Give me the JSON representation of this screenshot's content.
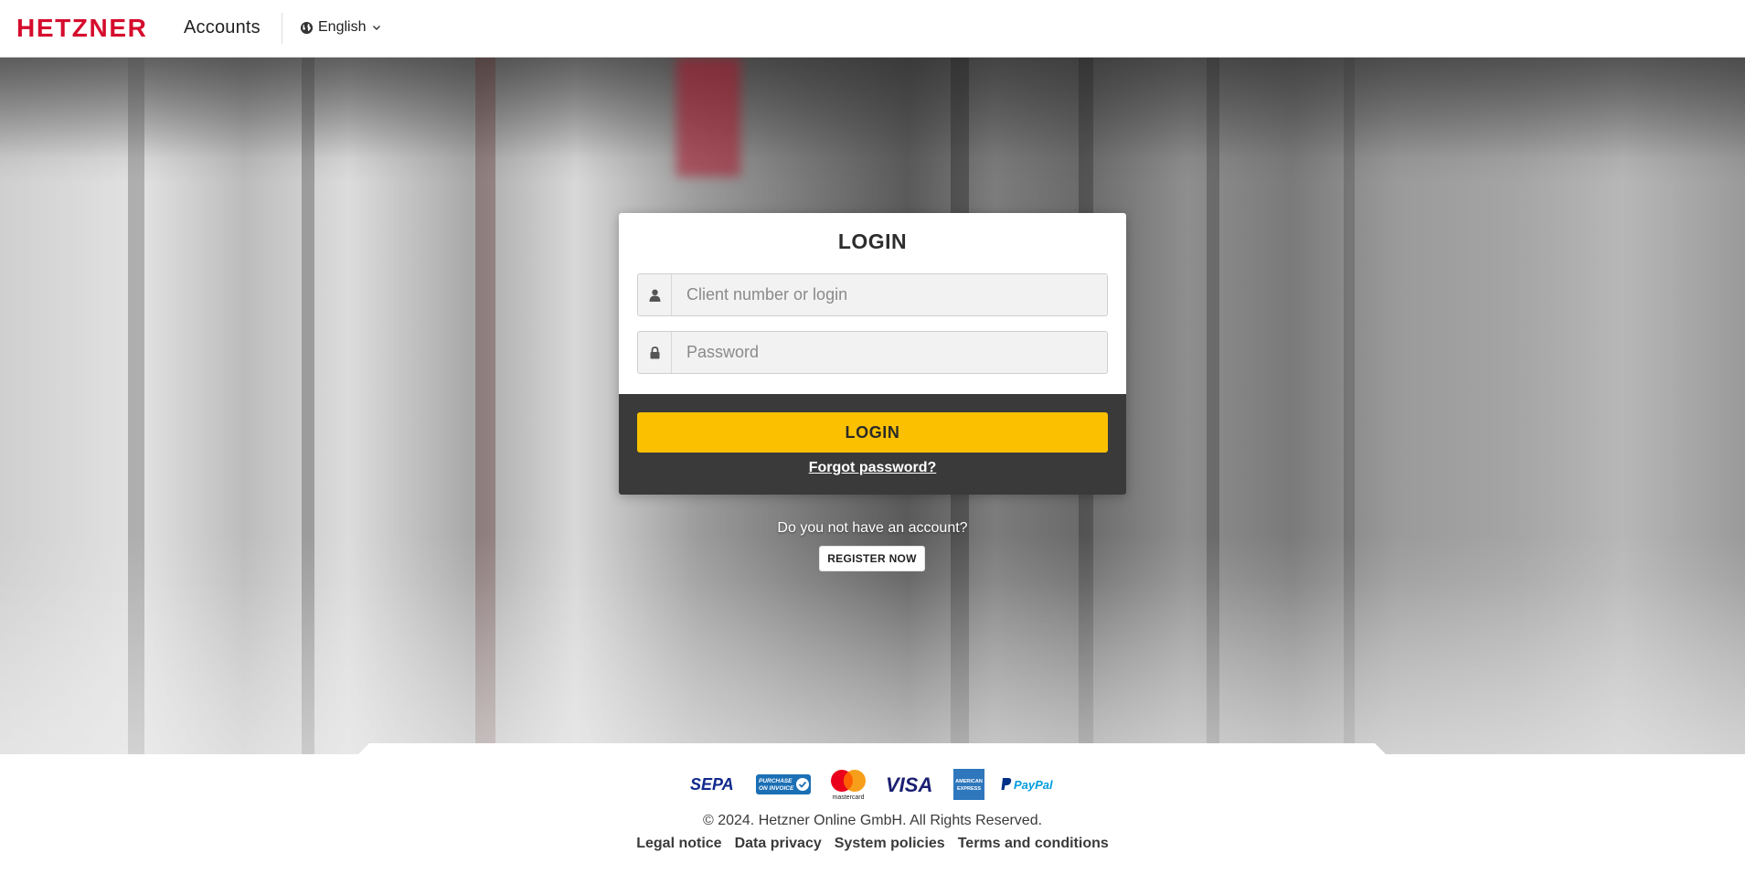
{
  "header": {
    "brand": "HETZNER",
    "app_name": "Accounts",
    "language": "English"
  },
  "login": {
    "title": "LOGIN",
    "username_placeholder": "Client number or login",
    "password_placeholder": "Password",
    "submit_label": "LOGIN",
    "forgot_label": "Forgot password?"
  },
  "register": {
    "question": "Do you not have an account?",
    "button_label": "REGISTER NOW"
  },
  "footer": {
    "payment_methods": [
      "sepa-logo",
      "purchase-on-invoice-logo",
      "mastercard-logo",
      "visa-logo",
      "american-express-logo",
      "paypal-logo"
    ],
    "payment_texts": {
      "sepa": "SEPA",
      "invoice_line1": "PURCHASE",
      "invoice_line2": "ON INVOICE",
      "mastercard": "mastercard",
      "visa": "VISA",
      "amex_line1": "AMERICAN",
      "amex_line2": "EXPRESS",
      "paypal": "PayPal"
    },
    "copyright": "© 2024. Hetzner Online GmbH. All Rights Reserved.",
    "links": {
      "legal": "Legal notice",
      "privacy": "Data privacy",
      "system": "System policies",
      "terms": "Terms and conditions"
    }
  },
  "colors": {
    "brand_red": "#d50c2d",
    "accent_yellow": "#fbc100",
    "card_dark": "#3a3a3a"
  }
}
